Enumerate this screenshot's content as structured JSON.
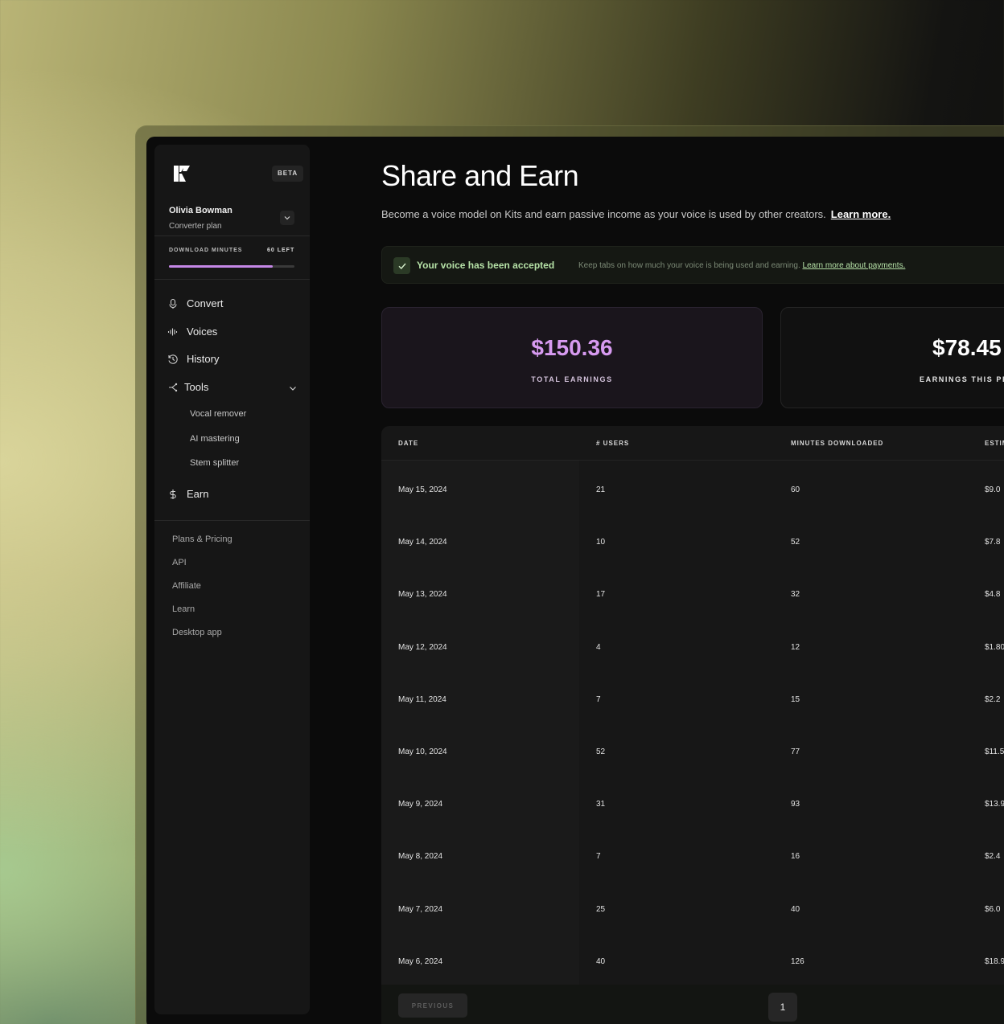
{
  "sidebar": {
    "beta_label": "BETA",
    "user": {
      "name": "Olivia Bowman",
      "plan": "Converter plan"
    },
    "download": {
      "label": "DOWNLOAD MINUTES",
      "left": "60 LEFT",
      "used_fraction": 0.83
    },
    "nav": [
      {
        "label": "Convert",
        "icon": "microphone-icon"
      },
      {
        "label": "Voices",
        "icon": "waveform-icon"
      },
      {
        "label": "History",
        "icon": "history-icon"
      },
      {
        "label": "Tools",
        "icon": "tools-icon"
      },
      {
        "label": "Earn",
        "icon": "dollar-icon"
      }
    ],
    "tools_sub": [
      "Vocal remover",
      "AI mastering",
      "Stem splitter"
    ],
    "footer": [
      "Plans & Pricing",
      "API",
      "Affiliate",
      "Learn",
      "Desktop app"
    ]
  },
  "main": {
    "title": "Share and Earn",
    "subtitle": "Become a voice model on Kits and earn passive income as your voice is used by other creators.",
    "subtitle_link": "Learn more.",
    "banner": {
      "title": "Your voice has been accepted",
      "text": "Keep tabs on how much your voice is being used and earning.",
      "link": "Learn more about payments."
    },
    "cards": [
      {
        "value": "$150.36",
        "label": "TOTAL EARNINGS"
      },
      {
        "value": "$78.45",
        "label": "EARNINGS THIS PERIOD"
      }
    ],
    "table": {
      "headers": [
        "DATE",
        "# USERS",
        "MINUTES DOWNLOADED",
        "ESTIMATED EARNINGS"
      ],
      "rows": [
        [
          "May 15, 2024",
          "21",
          "60",
          "$9.0"
        ],
        [
          "May 14, 2024",
          "10",
          "52",
          "$7.8"
        ],
        [
          "May 13, 2024",
          "17",
          "32",
          "$4.8"
        ],
        [
          "May 12, 2024",
          "4",
          "12",
          "$1.80"
        ],
        [
          "May 11, 2024",
          "7",
          "15",
          "$2.2"
        ],
        [
          "May 10, 2024",
          "52",
          "77",
          "$11.5"
        ],
        [
          "May 9, 2024",
          "31",
          "93",
          "$13.9"
        ],
        [
          "May 8, 2024",
          "7",
          "16",
          "$2.4"
        ],
        [
          "May 7, 2024",
          "25",
          "40",
          "$6.0"
        ],
        [
          "May 6, 2024",
          "40",
          "126",
          "$18.9"
        ]
      ],
      "prev_label": "PREVIOUS",
      "page": "1"
    }
  },
  "colors": {
    "accent": "#c487e6",
    "success": "#b7e3a8",
    "background": "#0b0b0b"
  }
}
